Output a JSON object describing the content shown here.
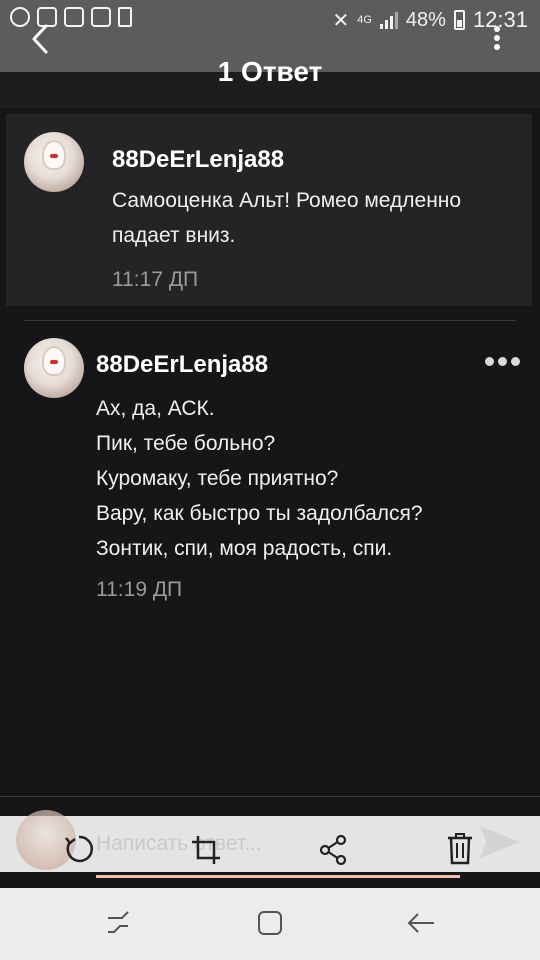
{
  "status_bar": {
    "left_icons": [
      "whatsapp-icon",
      "gmail-icon",
      "gallery-icon",
      "youtube-icon",
      "sdcard-icon"
    ],
    "network": "4G",
    "battery": "48%",
    "time": "12:31"
  },
  "header": {
    "title": "1 Ответ"
  },
  "comments": [
    {
      "username": "88DeErLenja88",
      "lines": [
        "Самооценка Альт! Ромео медленно",
        "падает вниз."
      ],
      "time": "11:17 ДП"
    },
    {
      "username": "88DeErLenja88",
      "lines": [
        "Ах, да, АСК.",
        "Пик, тебе больно?",
        "Куромаку, тебе приятно?",
        "Вару, как быстро ты задолбался?",
        "Зонтик, спи, моя радость, спи."
      ],
      "time": "11:19 ДП"
    }
  ],
  "reply_bar": {
    "placeholder": "Написать ответ..."
  },
  "colors": {
    "status_bar_bg": "#5e5b5d",
    "background": "#161517",
    "parent_comment_bg": "#242325",
    "timestamp": "#9a999b",
    "input_underline": "#f3c0b4"
  }
}
